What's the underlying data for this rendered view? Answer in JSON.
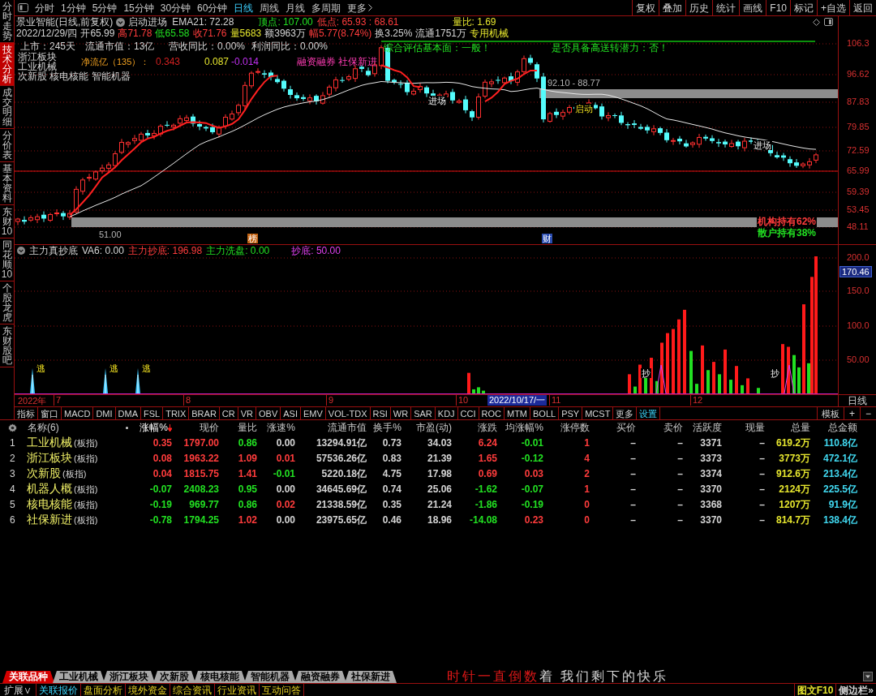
{
  "sidebar": {
    "tabs": [
      {
        "label": "分时走势",
        "selected": false
      },
      {
        "label": "技术分析",
        "selected": true
      },
      {
        "label": "成交明细",
        "selected": false
      },
      {
        "label": "分价表",
        "selected": false
      },
      {
        "label": "基本资料",
        "selected": false
      },
      {
        "label": "东财10",
        "selected": false
      },
      {
        "label": "同花顺10",
        "selected": false
      },
      {
        "label": "个股龙虎",
        "selected": false
      },
      {
        "label": "东财股吧",
        "selected": false
      }
    ]
  },
  "toolbar": {
    "periods": [
      {
        "label": "分时",
        "selected": false
      },
      {
        "label": "1分钟",
        "selected": false
      },
      {
        "label": "5分钟",
        "selected": false
      },
      {
        "label": "15分钟",
        "selected": false
      },
      {
        "label": "30分钟",
        "selected": false
      },
      {
        "label": "60分钟",
        "selected": false
      },
      {
        "label": "日线",
        "selected": true
      },
      {
        "label": "周线",
        "selected": false
      },
      {
        "label": "月线",
        "selected": false
      },
      {
        "label": "多周期",
        "selected": false
      }
    ],
    "more": "更多",
    "buttons": [
      "复权",
      "叠加",
      "历史",
      "统计",
      "画线",
      "F10",
      "标记",
      "+自选",
      "返回"
    ]
  },
  "header": {
    "title": "景业智能(日线,前复权)",
    "formula": "启动进场",
    "ema": "EMA21: 72.28",
    "peak": "顶点: 107.00",
    "trough": "低点: 65.93 : 68.61",
    "volume_ratio": "量比: 1.69",
    "quote": [
      {
        "text": "2022/12/29/四",
        "color": "#d4d4d4"
      },
      {
        "text": "开65.99",
        "color": "#d4d4d4"
      },
      {
        "text": "高71.78",
        "color": "#ff3c3c"
      },
      {
        "text": "低65.58",
        "color": "#22e022"
      },
      {
        "text": "收71.76",
        "color": "#ff3c3c"
      },
      {
        "text": "量5683",
        "color": "#e6e62e"
      },
      {
        "text": "额3963万",
        "color": "#d4d4d4"
      },
      {
        "text": "幅5.77(8.74%)",
        "color": "#ff3c3c"
      },
      {
        "text": "换3.25%",
        "color": "#d4d4d4"
      },
      {
        "text": "流通1751万",
        "color": "#d4d4d4"
      },
      {
        "text": "专用机械",
        "color": "#e6e62e"
      }
    ]
  },
  "price_chart": {
    "axis_labels": [
      "106.3",
      "96.62",
      "87.83",
      "79.85",
      "72.59",
      "65.99",
      "59.39",
      "53.45",
      "48.11"
    ],
    "stats": [
      "上市：245天",
      "流通市值：13亿",
      "营收同比：0.00%",
      "利润同比：0.00%"
    ],
    "sectors": [
      "浙江板块",
      "工业机械",
      "次新股 核电核能 智能机器"
    ],
    "net_flow": {
      "label": "净流亿（135）：",
      "values": [
        {
          "text": "0.343",
          "color": "#d02020"
        },
        {
          "text": "0.087",
          "color": "#e6e62e"
        },
        {
          "text": "-0.014",
          "color": "#c030f0"
        }
      ]
    },
    "concepts": "融资融券 社保新进",
    "assessment": "综合评估基本面：一般！",
    "split_potential": "是否具备高送转潜力：否！",
    "zone": "92.10 - 88.77",
    "signals": [
      {
        "text": "进场",
        "kind": "entry"
      },
      {
        "text": "启动",
        "kind": "start"
      },
      {
        "text": "进场",
        "kind": "entry"
      }
    ],
    "low_mark": "51.00",
    "holdings": [
      {
        "text": "机构持有62%",
        "color": "#ff3c3c"
      },
      {
        "text": "散户持有38%",
        "color": "#22e022"
      }
    ],
    "events": [
      {
        "text": "榜",
        "kind": "ranking"
      },
      {
        "text": "财",
        "kind": "finance"
      }
    ]
  },
  "indicator": {
    "name": "主力真抄底",
    "values": [
      {
        "text": "VA6: 0.00",
        "color": "#d4d4d4"
      },
      {
        "text": "主力抄底: 196.98",
        "color": "#ff3c3c"
      },
      {
        "text": "主力洗盘: 0.00",
        "color": "#22e022"
      },
      {
        "text": "抄底: 50.00",
        "color": "#e040f0"
      }
    ],
    "axis_labels": [
      "200.0",
      "150.0",
      "100.0",
      "50.00"
    ],
    "current": "170.46",
    "markers": [
      {
        "label": "逃",
        "kind": "sell"
      },
      {
        "label": "逃",
        "kind": "sell"
      },
      {
        "label": "逃",
        "kind": "sell"
      },
      {
        "label": "抄",
        "kind": "buy"
      },
      {
        "label": "抄",
        "kind": "buy"
      }
    ]
  },
  "time_axis": {
    "year": "2022年",
    "months": [
      "7",
      "8",
      "9",
      "10",
      "11",
      "12"
    ],
    "cursor": "2022/10/17/一",
    "period": "日线"
  },
  "indicator_tabs": {
    "items": [
      {
        "label": "指标",
        "selected": false
      },
      {
        "label": "窗口",
        "selected": false
      },
      {
        "label": "MACD",
        "selected": false
      },
      {
        "label": "DMI",
        "selected": false
      },
      {
        "label": "DMA",
        "selected": false
      },
      {
        "label": "FSL",
        "selected": false
      },
      {
        "label": "TRIX",
        "selected": false
      },
      {
        "label": "BRAR",
        "selected": false
      },
      {
        "label": "CR",
        "selected": false
      },
      {
        "label": "VR",
        "selected": false
      },
      {
        "label": "OBV",
        "selected": false
      },
      {
        "label": "ASI",
        "selected": false
      },
      {
        "label": "EMV",
        "selected": false
      },
      {
        "label": "VOL-TDX",
        "selected": false
      },
      {
        "label": "RSI",
        "selected": false
      },
      {
        "label": "WR",
        "selected": false
      },
      {
        "label": "SAR",
        "selected": false
      },
      {
        "label": "KDJ",
        "selected": false
      },
      {
        "label": "CCI",
        "selected": false
      },
      {
        "label": "ROC",
        "selected": false
      },
      {
        "label": "MTM",
        "selected": false
      },
      {
        "label": "BOLL",
        "selected": false
      },
      {
        "label": "PSY",
        "selected": false
      },
      {
        "label": "MCST",
        "selected": false
      },
      {
        "label": "更多",
        "selected": false
      },
      {
        "label": "设置",
        "selected": true
      }
    ],
    "template": "模板",
    "add": "+",
    "remove": "−"
  },
  "table": {
    "name_header": "名称(6)",
    "columns": [
      {
        "label": "涨幅%",
        "sorted": true
      },
      {
        "label": "现价",
        "sorted": false
      },
      {
        "label": "量比",
        "sorted": false
      },
      {
        "label": "涨速%",
        "sorted": false
      },
      {
        "label": "流通市值",
        "sorted": false
      },
      {
        "label": "换手%",
        "sorted": false
      },
      {
        "label": "市盈(动)",
        "sorted": false
      },
      {
        "label": "涨跌",
        "sorted": false
      },
      {
        "label": "均涨幅%",
        "sorted": false
      },
      {
        "label": "涨停数",
        "sorted": false
      },
      {
        "label": "买价",
        "sorted": false
      },
      {
        "label": "卖价",
        "sorted": false
      },
      {
        "label": "活跃度",
        "sorted": false
      },
      {
        "label": "现量",
        "sorted": false
      },
      {
        "label": "总量",
        "sorted": false
      },
      {
        "label": "总金额",
        "sorted": false
      }
    ],
    "rows": [
      {
        "no": "1",
        "name": "工业机械",
        "tag": "(板指)",
        "cells": [
          {
            "text": "0.35",
            "color": "#ff3c3c"
          },
          {
            "text": "1797.00",
            "color": "#ff3c3c"
          },
          {
            "text": "0.86",
            "color": "#22e022"
          },
          {
            "text": "0.00",
            "color": "#d4d4d4"
          },
          {
            "text": "13294.91亿",
            "color": "#d4d4d4"
          },
          {
            "text": "0.73",
            "color": "#d4d4d4"
          },
          {
            "text": "34.03",
            "color": "#d4d4d4"
          },
          {
            "text": "6.24",
            "color": "#ff3c3c"
          },
          {
            "text": "-0.01",
            "color": "#22e022"
          },
          {
            "text": "1",
            "color": "#ff3c3c"
          },
          {
            "text": "–"
          },
          {
            "text": "–"
          },
          {
            "text": "3371",
            "color": "#d4d4d4"
          },
          {
            "text": "–"
          },
          {
            "text": "619.2万",
            "color": "#e6e62e"
          },
          {
            "text": "110.8亿",
            "color": "#40d8f0"
          }
        ]
      },
      {
        "no": "2",
        "name": "浙江板块",
        "tag": "(板指)",
        "cells": [
          {
            "text": "0.08",
            "color": "#ff3c3c"
          },
          {
            "text": "1963.22",
            "color": "#ff3c3c"
          },
          {
            "text": "1.09",
            "color": "#ff3c3c"
          },
          {
            "text": "0.01",
            "color": "#ff3c3c"
          },
          {
            "text": "57536.26亿",
            "color": "#d4d4d4"
          },
          {
            "text": "0.83",
            "color": "#d4d4d4"
          },
          {
            "text": "21.39",
            "color": "#d4d4d4"
          },
          {
            "text": "1.65",
            "color": "#ff3c3c"
          },
          {
            "text": "-0.12",
            "color": "#22e022"
          },
          {
            "text": "4",
            "color": "#ff3c3c"
          },
          {
            "text": "–"
          },
          {
            "text": "–"
          },
          {
            "text": "3373",
            "color": "#d4d4d4"
          },
          {
            "text": "–"
          },
          {
            "text": "3773万",
            "color": "#e6e62e"
          },
          {
            "text": "472.1亿",
            "color": "#40d8f0"
          }
        ]
      },
      {
        "no": "3",
        "name": "次新股",
        "tag": "(板指)",
        "cells": [
          {
            "text": "0.04",
            "color": "#ff3c3c"
          },
          {
            "text": "1815.75",
            "color": "#ff3c3c"
          },
          {
            "text": "1.41",
            "color": "#ff3c3c"
          },
          {
            "text": "-0.01",
            "color": "#22e022"
          },
          {
            "text": "5220.18亿",
            "color": "#d4d4d4"
          },
          {
            "text": "4.75",
            "color": "#d4d4d4"
          },
          {
            "text": "17.98",
            "color": "#d4d4d4"
          },
          {
            "text": "0.69",
            "color": "#ff3c3c"
          },
          {
            "text": "0.03",
            "color": "#ff3c3c"
          },
          {
            "text": "2",
            "color": "#ff3c3c"
          },
          {
            "text": "–"
          },
          {
            "text": "–"
          },
          {
            "text": "3374",
            "color": "#d4d4d4"
          },
          {
            "text": "–"
          },
          {
            "text": "912.6万",
            "color": "#e6e62e"
          },
          {
            "text": "213.4亿",
            "color": "#40d8f0"
          }
        ]
      },
      {
        "no": "4",
        "name": "机器人概",
        "tag": "(板指)",
        "cells": [
          {
            "text": "-0.07",
            "color": "#22e022"
          },
          {
            "text": "2408.23",
            "color": "#22e022"
          },
          {
            "text": "0.95",
            "color": "#22e022"
          },
          {
            "text": "0.00",
            "color": "#d4d4d4"
          },
          {
            "text": "34645.69亿",
            "color": "#d4d4d4"
          },
          {
            "text": "0.74",
            "color": "#d4d4d4"
          },
          {
            "text": "25.06",
            "color": "#d4d4d4"
          },
          {
            "text": "-1.62",
            "color": "#22e022"
          },
          {
            "text": "-0.07",
            "color": "#22e022"
          },
          {
            "text": "1",
            "color": "#ff3c3c"
          },
          {
            "text": "–"
          },
          {
            "text": "–"
          },
          {
            "text": "3370",
            "color": "#d4d4d4"
          },
          {
            "text": "–"
          },
          {
            "text": "2124万",
            "color": "#e6e62e"
          },
          {
            "text": "225.5亿",
            "color": "#40d8f0"
          }
        ]
      },
      {
        "no": "5",
        "name": "核电核能",
        "tag": "(板指)",
        "cells": [
          {
            "text": "-0.19",
            "color": "#22e022"
          },
          {
            "text": "969.77",
            "color": "#22e022"
          },
          {
            "text": "0.86",
            "color": "#22e022"
          },
          {
            "text": "0.02",
            "color": "#ff3c3c"
          },
          {
            "text": "21338.59亿",
            "color": "#d4d4d4"
          },
          {
            "text": "0.35",
            "color": "#d4d4d4"
          },
          {
            "text": "21.24",
            "color": "#d4d4d4"
          },
          {
            "text": "-1.86",
            "color": "#22e022"
          },
          {
            "text": "-0.19",
            "color": "#22e022"
          },
          {
            "text": "0",
            "color": "#ff3c3c"
          },
          {
            "text": "–"
          },
          {
            "text": "–"
          },
          {
            "text": "3368",
            "color": "#d4d4d4"
          },
          {
            "text": "–"
          },
          {
            "text": "1207万",
            "color": "#e6e62e"
          },
          {
            "text": "91.9亿",
            "color": "#40d8f0"
          }
        ]
      },
      {
        "no": "6",
        "name": "社保新进",
        "tag": "(板指)",
        "cells": [
          {
            "text": "-0.78",
            "color": "#22e022"
          },
          {
            "text": "1794.25",
            "color": "#22e022"
          },
          {
            "text": "1.02",
            "color": "#ff3c3c"
          },
          {
            "text": "0.00",
            "color": "#d4d4d4"
          },
          {
            "text": "23975.65亿",
            "color": "#d4d4d4"
          },
          {
            "text": "0.46",
            "color": "#d4d4d4"
          },
          {
            "text": "18.96",
            "color": "#d4d4d4"
          },
          {
            "text": "-14.08",
            "color": "#22e022"
          },
          {
            "text": "0.23",
            "color": "#ff3c3c"
          },
          {
            "text": "0",
            "color": "#ff3c3c"
          },
          {
            "text": "–"
          },
          {
            "text": "–"
          },
          {
            "text": "3370",
            "color": "#d4d4d4"
          },
          {
            "text": "–"
          },
          {
            "text": "814.7万",
            "color": "#e6e62e"
          },
          {
            "text": "138.4亿",
            "color": "#40d8f0"
          }
        ]
      }
    ]
  },
  "related_tabs": [
    {
      "label": "关联品种",
      "selected": true
    },
    {
      "label": "工业机械",
      "selected": false
    },
    {
      "label": "浙江板块",
      "selected": false
    },
    {
      "label": "次新股",
      "selected": false
    },
    {
      "label": "核电核能",
      "selected": false
    },
    {
      "label": "智能机器",
      "selected": false
    },
    {
      "label": "融资融券",
      "selected": false
    },
    {
      "label": "社保新进",
      "selected": false
    }
  ],
  "slogan": [
    {
      "text": "时针一直倒数",
      "color": "#e01818"
    },
    {
      "text": "着 我们剩下的快乐",
      "color": "#d8d8d8"
    }
  ],
  "status_bar": {
    "expand": "扩展∨",
    "links": [
      {
        "label": "关联报价",
        "selected": true
      },
      {
        "label": "盘面分析",
        "selected": false
      },
      {
        "label": "境外资金",
        "selected": false
      },
      {
        "label": "综合资讯",
        "selected": false
      },
      {
        "label": "行业资讯",
        "selected": false
      },
      {
        "label": "互动问答",
        "selected": false
      }
    ],
    "side": [
      {
        "text": "图文F10",
        "color": "#e6e62e"
      },
      {
        "text": "侧边栏»",
        "color": "#d4d4d4"
      }
    ]
  }
}
